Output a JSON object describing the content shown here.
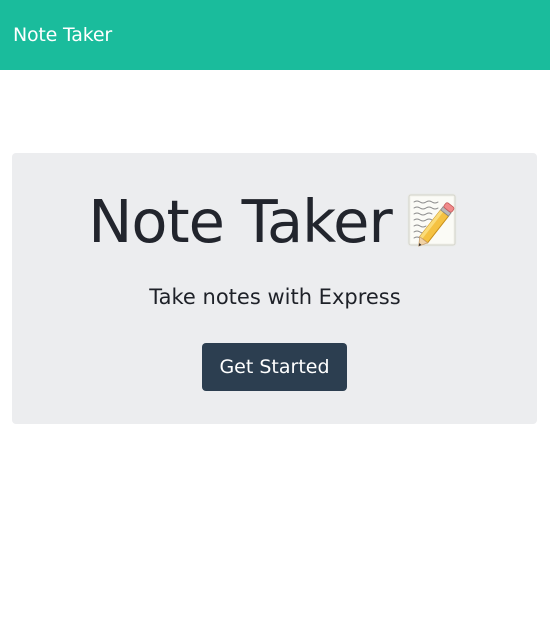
{
  "navbar": {
    "brand": "Note Taker"
  },
  "hero": {
    "title": "Note Taker",
    "title_icon": "memo-icon",
    "subtitle": "Take notes with Express",
    "button_label": "Get Started"
  },
  "colors": {
    "navbar_bg": "#1abc9c",
    "jumbotron_bg": "#ecedef",
    "button_bg": "#2c3e50",
    "text_dark": "#22252d"
  }
}
